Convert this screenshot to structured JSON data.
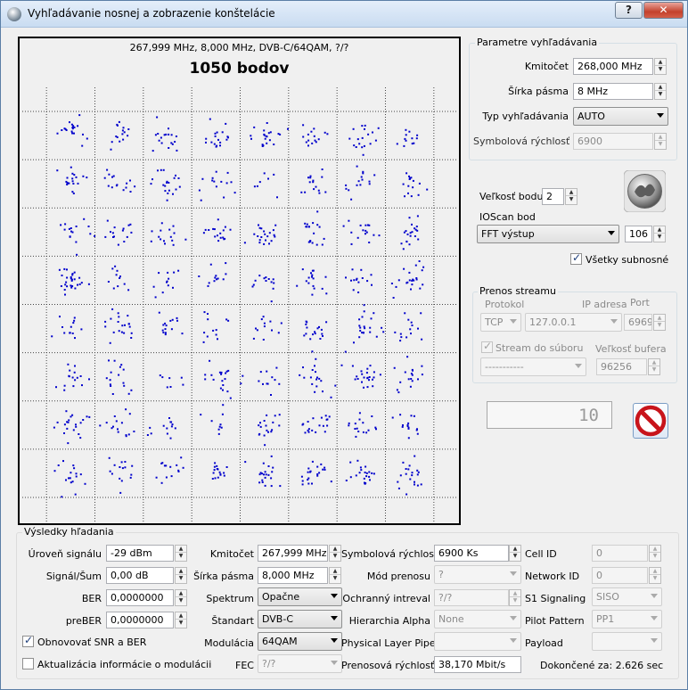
{
  "window": {
    "title": "Vyhľadávanie nosnej a zobrazenie konštelácie",
    "help": "?",
    "close": "✕"
  },
  "plot": {
    "subtitle": "267,999 MHz, 8,000 MHz, DVB-C/64QAM, ?/?",
    "title": "1050 bodov",
    "point_color": "#0000cc"
  },
  "chart_data": {
    "type": "scatter",
    "title": "1050 bodov",
    "subtitle": "267,999 MHz, 8,000 MHz, DVB-C/64QAM, ?/?",
    "points_total": 1050,
    "constellation": "64QAM",
    "grid_i": [
      -7,
      -5,
      -3,
      -1,
      1,
      3,
      5,
      7
    ],
    "grid_q": [
      -7,
      -5,
      -3,
      -1,
      1,
      3,
      5,
      7
    ],
    "xlim": [
      -9,
      9
    ],
    "ylim": [
      -9,
      9
    ],
    "grid": true,
    "xlabel": "",
    "ylabel": ""
  },
  "search_params": {
    "title": "Parametre vyhľadávania",
    "freq_label": "Kmitočet",
    "freq_value": "268,000 MHz",
    "bw_label": "Šírka pásma",
    "bw_value": "8 MHz",
    "type_label": "Typ vyhľadávania",
    "type_value": "AUTO",
    "sr_label": "Symbolová rýchlosť",
    "sr_value": "6900"
  },
  "point": {
    "size_label": "Veľkosť bodu",
    "size_value": "2",
    "ioscan_label": "IOScan bod",
    "ioscan_value": "FFT výstup",
    "ioscan_num": "106",
    "all_carriers_label": "Všetky subnosné"
  },
  "stream": {
    "title": "Prenos streamu",
    "protocol_label": "Protokol",
    "protocol_value": "TCP",
    "ip_label": "IP adresa",
    "ip_value": "127.0.0.1",
    "port_label": "Port",
    "port_value": "6969",
    "file_label": "Stream do súboru",
    "file_value": "-----------",
    "buffer_label": "Veľkosť bufera",
    "buffer_value": "96256"
  },
  "counter": {
    "value": "10"
  },
  "results": {
    "title": "Výsledky hľadania",
    "level_label": "Úroveň signálu",
    "level_value": "-29 dBm",
    "snr_label": "Signál/Šum",
    "snr_value": "0,00 dB",
    "ber_label": "BER",
    "ber_value": "0,0000000",
    "preber_label": "preBER",
    "preber_value": "0,0000000",
    "refresh_label": "Obnovovať SNR a BER",
    "update_label": "Aktualizácia informácie o modulácii",
    "freq_label": "Kmitočet",
    "freq_value": "267,999 MHz",
    "bw_label": "Šírka pásma",
    "bw_value": "8,000 MHz",
    "spectrum_label": "Spektrum",
    "spectrum_value": "Opačne",
    "standard_label": "Štandart",
    "standard_value": "DVB-C",
    "mod_label": "Modulácia",
    "mod_value": "64QAM",
    "fec_label": "FEC",
    "fec_value": "?/?",
    "sr_label": "Symbolová rýchlosť",
    "sr_value": "6900 Ks",
    "txmode_label": "Mód prenosu",
    "txmode_value": "?",
    "guard_label": "Ochranný intreval",
    "guard_value": "?/?",
    "alpha_label": "Hierarchia Alpha",
    "alpha_value": "None",
    "plp_label": "Physical Layer Pipe",
    "plp_value": "",
    "rate_label": "Prenosová rýchlosť",
    "rate_value": "38,170 Mbit/s",
    "cellid_label": "Cell ID",
    "cellid_value": "0",
    "netid_label": "Network ID",
    "netid_value": "0",
    "s1_label": "S1 Signaling",
    "s1_value": "SISO",
    "pilot_label": "Pilot Pattern",
    "pilot_value": "PP1",
    "payload_label": "Payload",
    "payload_value": "",
    "done_label": "Dokončené za: 2.626 sec"
  }
}
